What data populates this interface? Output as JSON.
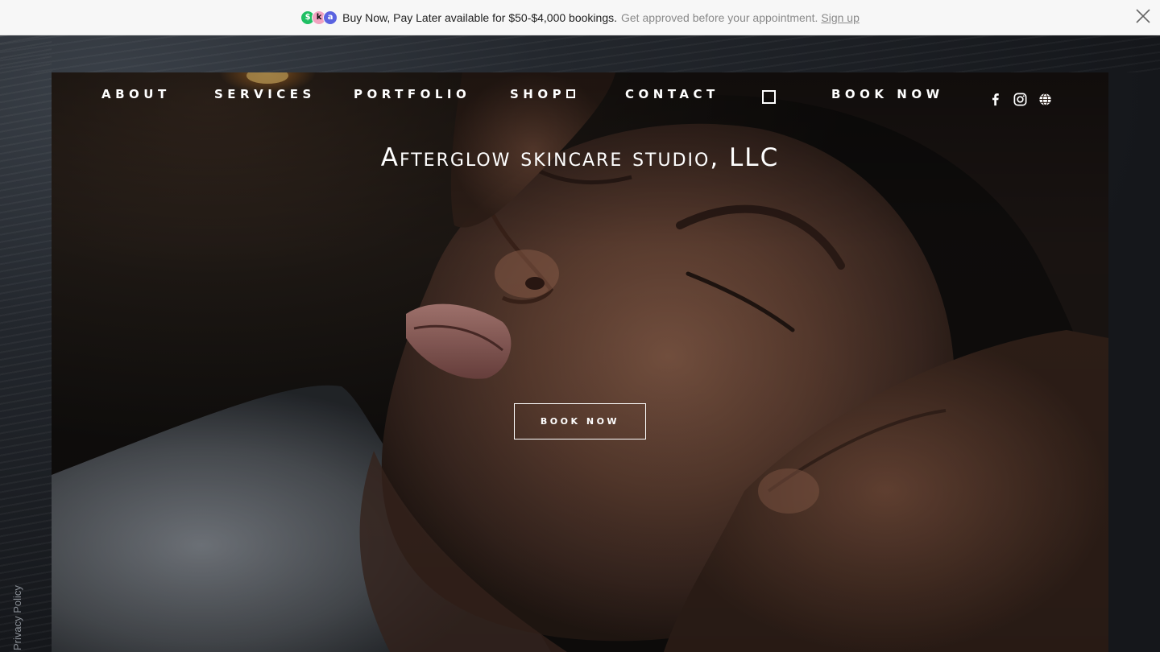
{
  "promo": {
    "main_text": "Buy Now, Pay Later available for $50-$4,000 bookings.",
    "sub_text": "Get approved before your appointment.",
    "link_text": "Sign up",
    "logos": [
      {
        "name": "afterpay-logo",
        "glyph": "$",
        "color": "#1fbf63"
      },
      {
        "name": "klarna-logo",
        "glyph": "k",
        "color": "#f2a2c0"
      },
      {
        "name": "affirm-logo",
        "glyph": "a",
        "color": "#5a63e0"
      }
    ]
  },
  "nav": {
    "items": [
      "ABOUT",
      "SERVICES",
      "PORTFOLIO",
      "SHOP",
      "CONTACT",
      "BOOK NOW"
    ]
  },
  "social": {
    "icons": [
      "facebook-icon",
      "instagram-icon",
      "globe-icon"
    ]
  },
  "hero": {
    "title": "Afterglow skincare studio, LLC",
    "cta_label": "BOOK NOW"
  },
  "footer": {
    "privacy_label": "Privacy Policy"
  },
  "colors": {
    "banner_bg": "#f7f7f7",
    "page_bg": "#16181c",
    "text_light": "#ffffff"
  }
}
